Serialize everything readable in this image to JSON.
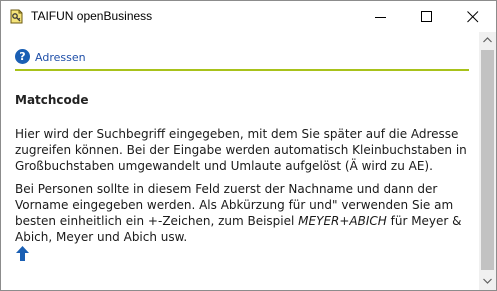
{
  "window": {
    "title": "TAIFUN openBusiness"
  },
  "help": {
    "link_label": "Adressen",
    "heading": "Matchcode",
    "paragraph1": "Hier wird der Suchbegriff eingegeben, mit dem Sie später auf die Adresse zugreifen können. Bei der Eingabe werden automatisch Kleinbuchstaben in Großbuchstaben umgewandelt und Umlaute aufgelöst (Ä wird zu AE).",
    "paragraph2_before": "Bei Personen sollte in diesem Feld zuerst der Nachname und dann der Vorname eingegeben werden. Als Abkürzung für und\" verwenden Sie am besten einheitlich ein +-Zeichen, zum Beispiel ",
    "paragraph2_example": "MEYER+ABICH",
    "paragraph2_after": " für Meyer & Abich, Meyer und Abich usw."
  },
  "icons": {
    "app": "document-key-icon",
    "help": "question-circle-icon",
    "up": "arrow-up-icon"
  },
  "colors": {
    "accent_rule": "#a8c21a",
    "link": "#1f4fa8",
    "help_icon": "#1a5fb4"
  }
}
